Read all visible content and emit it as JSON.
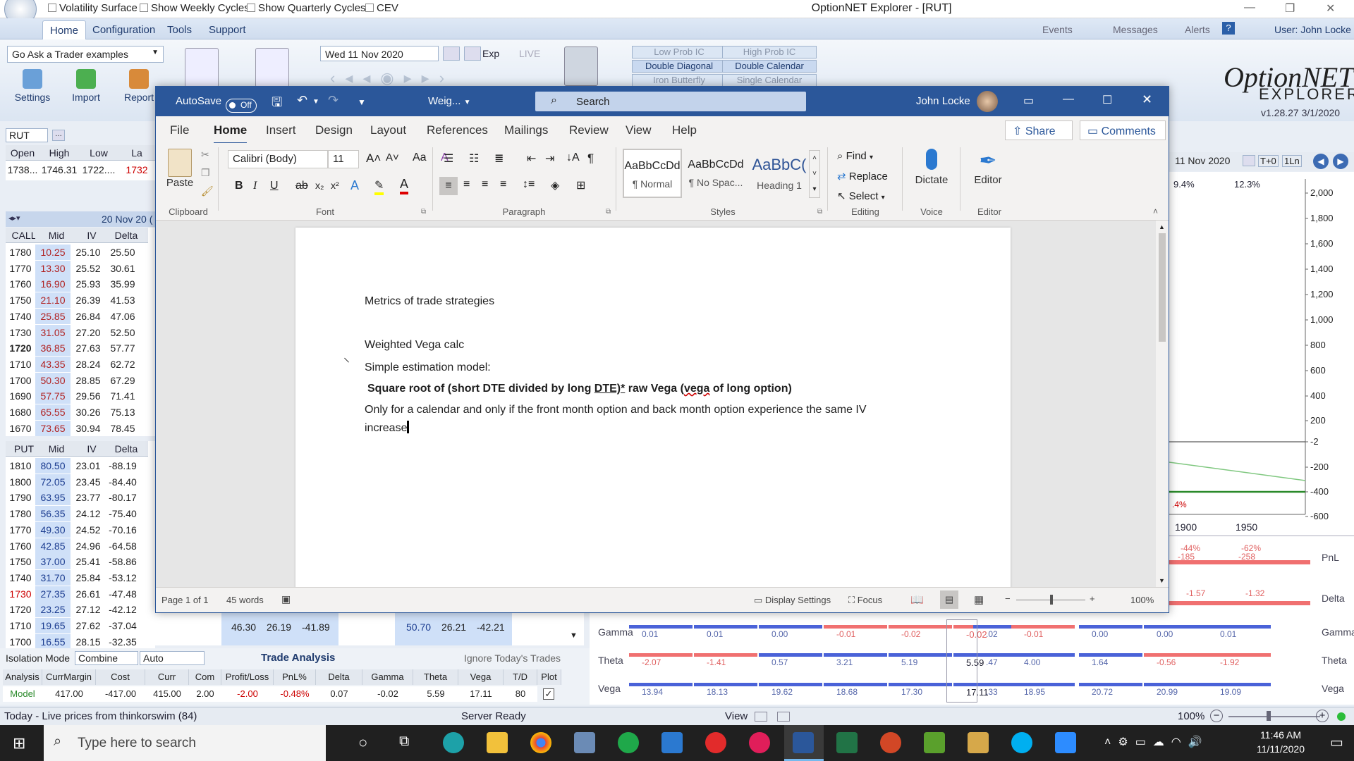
{
  "optionnet": {
    "checkboxes": [
      "Volatility Surface",
      "Show Weekly Cycles",
      "Show Quarterly Cycles",
      "CEV"
    ],
    "window_title": "OptionNET Explorer - [RUT]",
    "menu": [
      "Home",
      "Configuration",
      "Tools",
      "Support"
    ],
    "menu_right": [
      "Events",
      "Messages",
      "Alerts"
    ],
    "user": "User: John Locke",
    "example_combo": "Go Ask a Trader examples",
    "ribbon_buttons": [
      "Settings",
      "Import",
      "Report"
    ],
    "date": "Wed 11 Nov 2020",
    "exp": "Exp",
    "live": "LIVE",
    "strategies": [
      "Low Prob IC",
      "High Prob IC",
      "Double Diagonal",
      "Double Calendar",
      "Iron Butterfly",
      "Single Calendar"
    ],
    "logo": "OptionNET",
    "logo_sub": "EXPLORER",
    "version": "v1.28.27  3/1/2020",
    "symbol": "RUT",
    "quote_headers": [
      "Open",
      "High",
      "Low",
      "La"
    ],
    "quote_values": [
      "1738...",
      "1746.31",
      "1722....",
      "1732"
    ],
    "expiry_label": "20 Nov 20 (",
    "call_headers": [
      "CALL",
      "Mid",
      "IV",
      "Delta"
    ],
    "calls": [
      [
        "1780",
        "10.25",
        "25.10",
        "25.50"
      ],
      [
        "1770",
        "13.30",
        "25.52",
        "30.61"
      ],
      [
        "1760",
        "16.90",
        "25.93",
        "35.99"
      ],
      [
        "1750",
        "21.10",
        "26.39",
        "41.53"
      ],
      [
        "1740",
        "25.85",
        "26.84",
        "47.06"
      ],
      [
        "1730",
        "31.05",
        "27.20",
        "52.50"
      ],
      [
        "1720",
        "36.85",
        "27.63",
        "57.77"
      ],
      [
        "1710",
        "43.35",
        "28.24",
        "62.72"
      ],
      [
        "1700",
        "50.30",
        "28.85",
        "67.29"
      ],
      [
        "1690",
        "57.75",
        "29.56",
        "71.41"
      ],
      [
        "1680",
        "65.55",
        "30.26",
        "75.13"
      ],
      [
        "1670",
        "73.65",
        "30.94",
        "78.45"
      ]
    ],
    "put_headers": [
      "PUT",
      "Mid",
      "IV",
      "Delta"
    ],
    "puts": [
      [
        "1810",
        "80.50",
        "23.01",
        "-88.19"
      ],
      [
        "1800",
        "72.05",
        "23.45",
        "-84.40"
      ],
      [
        "1790",
        "63.95",
        "23.77",
        "-80.17"
      ],
      [
        "1780",
        "56.35",
        "24.12",
        "-75.40"
      ],
      [
        "1770",
        "49.30",
        "24.52",
        "-70.16"
      ],
      [
        "1760",
        "42.85",
        "24.96",
        "-64.58"
      ],
      [
        "1750",
        "37.00",
        "25.41",
        "-58.86"
      ],
      [
        "1740",
        "31.70",
        "25.84",
        "-53.12"
      ],
      [
        "1730",
        "27.35",
        "26.61",
        "-47.48"
      ],
      [
        "1720",
        "23.25",
        "27.12",
        "-42.12"
      ],
      [
        "1710",
        "19.65",
        "27.62",
        "-37.04"
      ],
      [
        "1700",
        "16.55",
        "28.15",
        "-32.35"
      ]
    ],
    "extra_row": [
      "46.30",
      "26.19",
      "-41.89",
      "50.70",
      "26.21",
      "-42.21"
    ],
    "isolation_mode": "Isolation Mode",
    "isolation_value": "Combine",
    "auto_value": "Auto",
    "trade_analysis": "Trade Analysis",
    "ignore_today": "Ignore Today's Trades",
    "analysis_headers": [
      "Analysis",
      "CurrMargin",
      "Cost",
      "Curr",
      "Com",
      "Profit/Loss",
      "PnL%",
      "Delta",
      "Gamma",
      "Theta",
      "Vega",
      "T/D",
      "Plot"
    ],
    "analysis_values": [
      "Model",
      "417.00",
      "-417.00",
      "415.00",
      "2.00",
      "-2.00",
      "-0.48%",
      "0.07",
      "-0.02",
      "5.59",
      "17.11",
      "80"
    ],
    "right_date": "11 Nov 2020",
    "right_buttons": [
      "T+0",
      "1Ln"
    ],
    "iv_labels": [
      "9.4%",
      "12.3%"
    ],
    "y_axis": [
      "2,000",
      "1,800",
      "1,600",
      "1,400",
      "1,200",
      "1,000",
      "800",
      "600",
      "400",
      "200",
      "-2",
      "-200",
      "-400",
      "-600"
    ],
    "x_axis": [
      "1900",
      "1950"
    ],
    "chart_pct": ".4%",
    "pnl_vals": [
      "-44%",
      "-62%",
      "-185",
      "-258"
    ],
    "greek_labels": [
      "PnL",
      "Delta",
      "Gamma",
      "Theta",
      "Vega"
    ],
    "delta_vals": [
      "-1.57",
      "-1.32"
    ],
    "gamma_vals": [
      "0.01",
      "0.01",
      "0.00",
      "-0.01",
      "-0.02",
      "-0.02",
      ".02",
      "-0.01",
      "0.00",
      "0.00",
      "0.01"
    ],
    "theta_vals": [
      "-2.07",
      "-1.41",
      "0.57",
      "3.21",
      "5.19",
      "5.59",
      ".47",
      "4.00",
      "1.64",
      "-0.56",
      "-1.92"
    ],
    "vega_vals": [
      "13.94",
      "18.13",
      "19.62",
      "18.68",
      "17.30",
      "17.11",
      ".33",
      "18.95",
      "20.72",
      "20.99",
      "19.09"
    ],
    "status_left": "Today - Live prices from thinkorswim (84)",
    "status_mid": "Server Ready",
    "status_view": "View",
    "status_zoom": "100%"
  },
  "word": {
    "autosave": "AutoSave",
    "autosave_state": "Off",
    "doc_name": "Weig...",
    "search": "Search",
    "user": "John Locke",
    "tabs": [
      "File",
      "Home",
      "Insert",
      "Design",
      "Layout",
      "References",
      "Mailings",
      "Review",
      "View",
      "Help"
    ],
    "share": "Share",
    "comments": "Comments",
    "paste": "Paste",
    "clipboard": "Clipboard",
    "font_name": "Calibri (Body)",
    "font_size": "11",
    "font_group": "Font",
    "paragraph_group": "Paragraph",
    "styles_group": "Styles",
    "styles": [
      {
        "preview": "AaBbCcDd",
        "label": "¶ Normal"
      },
      {
        "preview": "AaBbCcDd",
        "label": "¶ No Spac..."
      },
      {
        "preview": "AaBbC(",
        "label": "Heading 1"
      }
    ],
    "find": "Find",
    "replace": "Replace",
    "select": "Select",
    "editing_group": "Editing",
    "dictate": "Dictate",
    "voice_group": "Voice",
    "editor": "Editor",
    "editor_group": "Editor",
    "doc": {
      "line1": "Metrics of trade strategies",
      "line2": "Weighted Vega calc",
      "line3": "Simple estimation model:",
      "line4a": "Square root of (short DTE divided by long ",
      "line4b": "DTE)*",
      "line4c": " raw Vega (",
      "line4d": "vega",
      "line4e": " of long option)",
      "line5": "Only for a calendar and only if the front month option and back month option experience the same IV",
      "line6": "increase"
    },
    "status": {
      "page": "Page 1 of 1",
      "words": "45 words",
      "display_settings": "Display Settings",
      "focus": "Focus",
      "zoom": "100%"
    }
  },
  "taskbar": {
    "search_placeholder": "Type here to search",
    "time": "11:46 AM",
    "date": "11/11/2020"
  }
}
